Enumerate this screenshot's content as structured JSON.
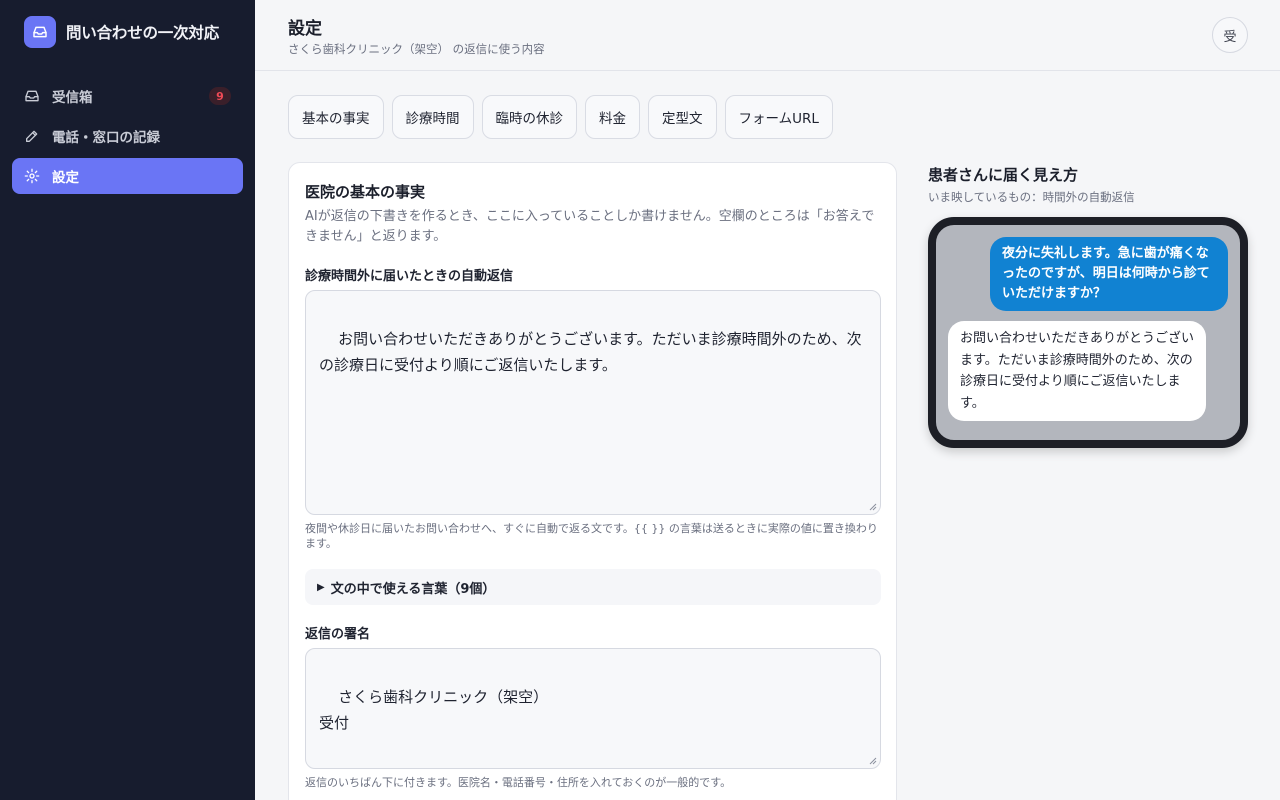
{
  "app": {
    "title": "問い合わせの一次対応"
  },
  "sidebar": {
    "items": [
      {
        "label": "受信箱",
        "icon": "inbox-icon",
        "badge": "9"
      },
      {
        "label": "電話・窓口の記録",
        "icon": "pencil-icon"
      },
      {
        "label": "設定",
        "icon": "gear-icon",
        "active": true
      }
    ]
  },
  "header": {
    "title": "設定",
    "subtitle": "さくら歯科クリニック（架空） の返信に使う内容",
    "avatar": "受"
  },
  "tabs": [
    "基本の事実",
    "診療時間",
    "臨時の休診",
    "料金",
    "定型文",
    "フォームURL"
  ],
  "card": {
    "title": "医院の基本の事実",
    "description": "AIが返信の下書きを作るとき、ここに入っていることしか書けません。空欄のところは「お答えできません」と返ります。",
    "auto_reply": {
      "label": "診療時間外に届いたときの自動返信",
      "value": "お問い合わせいただきありがとうございます。ただいま診療時間外のため、次の診療日に受付より順にご返信いたします。",
      "help": "夜間や休診日に届いたお問い合わせへ、すぐに自動で返る文です。{{ }} の言葉は送るときに実際の値に置き換わります。"
    },
    "variables_toggle": "文の中で使える言葉（9個）",
    "signature": {
      "label": "返信の署名",
      "value": "さくら歯科クリニック（架空）\n受付",
      "help": "返信のいちばん下に付きます。医院名・電話番号・住所を入れておくのが一般的です。"
    }
  },
  "preview": {
    "title": "患者さんに届く見え方",
    "subtitle": "いま映しているもの：時間外の自動返信",
    "patient_message": "夜分に失礼します。急に歯が痛くなったのですが、明日は何時から診ていただけますか？",
    "reply_message": "お問い合わせいただきありがとうございます。ただいま診療時間外のため、次の診療日に受付より順にご返信いたします。"
  },
  "colors": {
    "sidebar_bg": "#171c2e",
    "accent": "#6a75f5",
    "badge_text": "#ef4a56",
    "bubble_out": "#1182d2"
  }
}
